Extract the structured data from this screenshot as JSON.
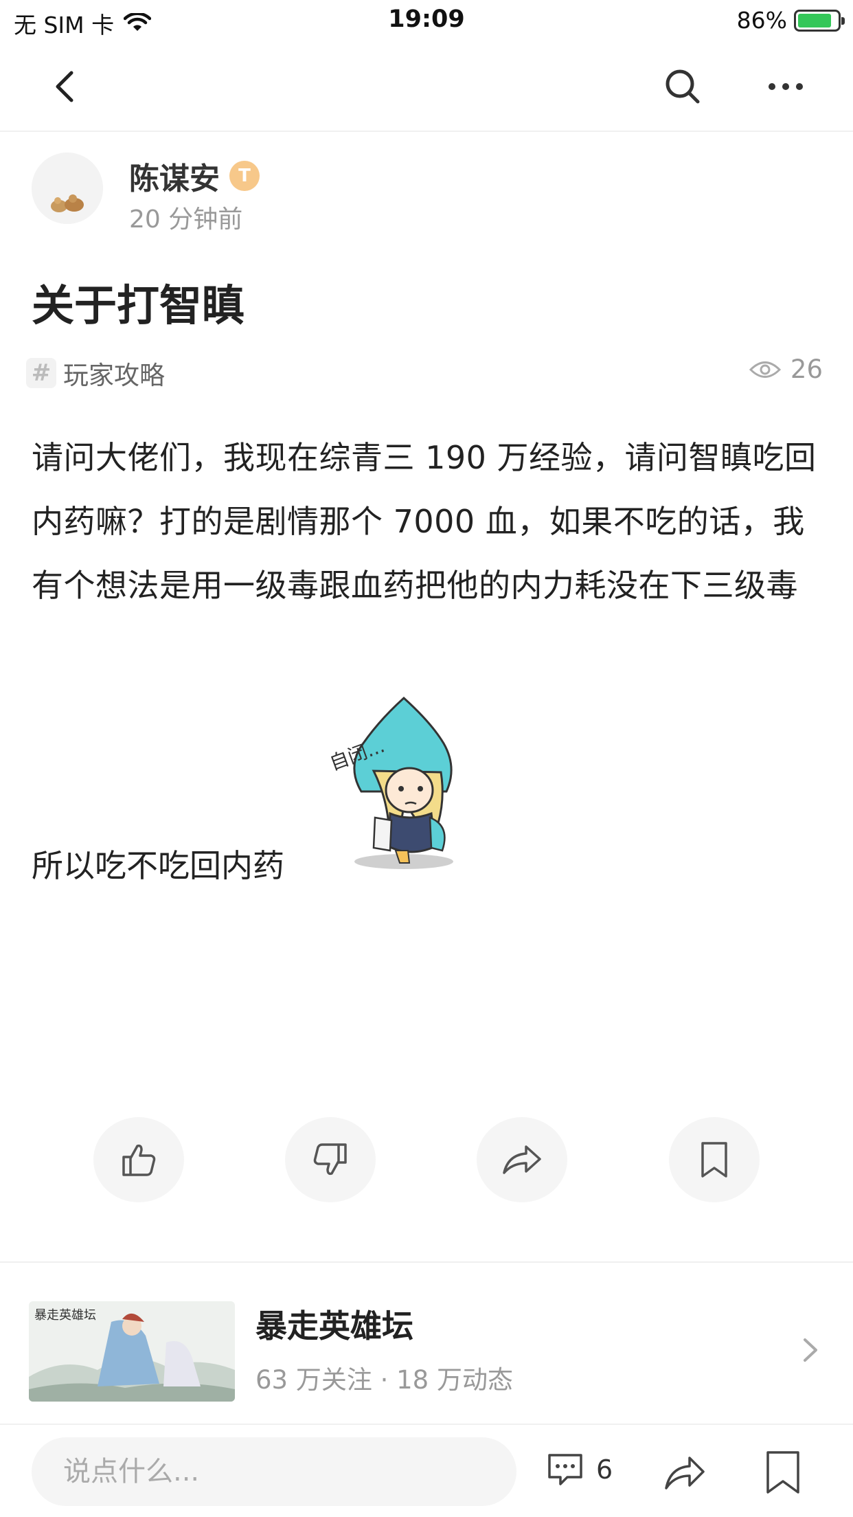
{
  "status_bar": {
    "carrier": "无 SIM 卡",
    "time": "19:09",
    "battery": "86%",
    "battery_level": 0.86
  },
  "nav": {
    "back_icon": "chevron-left-icon",
    "search_icon": "search-icon",
    "more_icon": "more-icon"
  },
  "author": {
    "name": "陈谋安",
    "badge": "T",
    "time": "20 分钟前"
  },
  "post": {
    "title": "关于打智瞋",
    "tag": "玩家攻略",
    "views": "26",
    "body": "请问大佬们，我现在综青三 190 万经验，请问智瞋吃回内药嘛？打的是剧情那个 7000 血，如果不吃的话，我有个想法是用一级毒跟血药把他的内力耗没在下三级毒",
    "body2": "所以吃不吃回内药",
    "sticker_text": "自闭...",
    "sticker_label": "sticker"
  },
  "reactions": [
    {
      "name": "like-button",
      "icon": "thumbs-up-icon"
    },
    {
      "name": "dislike-button",
      "icon": "thumbs-down-icon"
    },
    {
      "name": "share-button",
      "icon": "share-arrow-icon"
    },
    {
      "name": "save-button",
      "icon": "bookmark-icon"
    }
  ],
  "forum": {
    "name": "暴走英雄坛",
    "stats": "63 万关注 · 18 万动态",
    "thumb_text": "暴走英雄坛"
  },
  "bottom_bar": {
    "placeholder": "说点什么...",
    "comment_count": "6"
  },
  "colors": {
    "badge": "#f7c88a",
    "battery": "#34c759",
    "sticker_hair": "#5ccfd6"
  }
}
